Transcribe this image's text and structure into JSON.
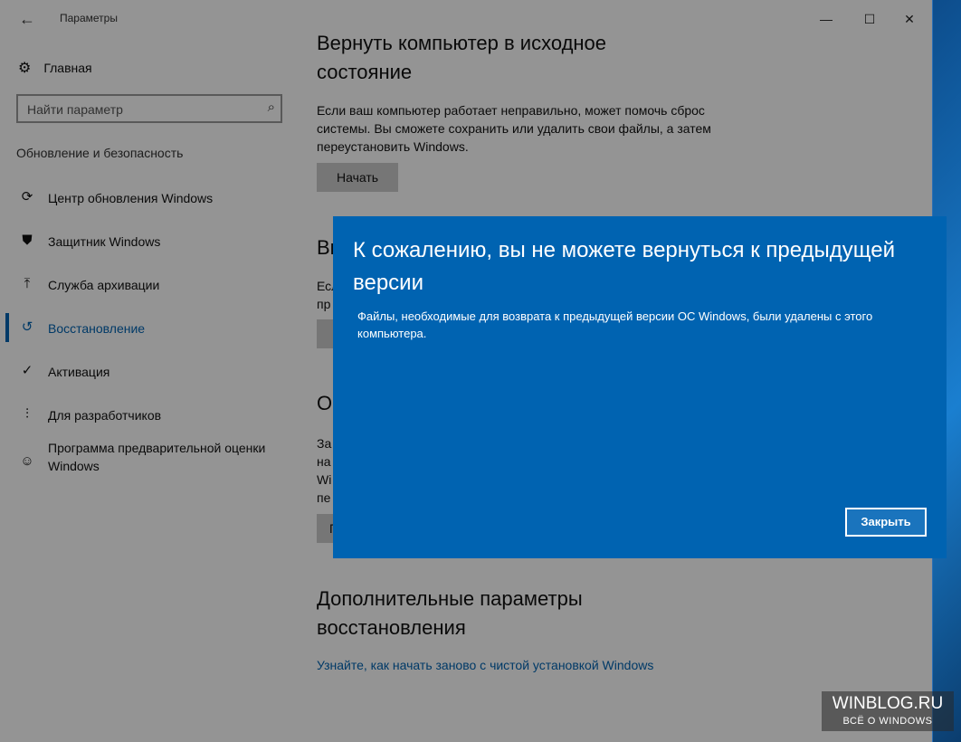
{
  "window": {
    "title": "Параметры",
    "back_glyph": "←",
    "minimize_glyph": "—",
    "maximize_glyph": "☐",
    "close_glyph": "✕"
  },
  "sidebar": {
    "home_label": "Главная",
    "home_icon": "gear-icon",
    "search_placeholder": "Найти параметр",
    "search_icon": "search-icon",
    "section_title": "Обновление и безопасность",
    "items": [
      {
        "label": "Центр обновления Windows",
        "icon": "refresh-icon",
        "glyph": "⟳",
        "active": false
      },
      {
        "label": "Защитник Windows",
        "icon": "shield-icon",
        "glyph": "⛊",
        "active": false
      },
      {
        "label": "Служба архивации",
        "icon": "backup-icon",
        "glyph": "⤒",
        "active": false
      },
      {
        "label": "Восстановление",
        "icon": "history-icon",
        "glyph": "↺",
        "active": true
      },
      {
        "label": "Активация",
        "icon": "check-circle-icon",
        "glyph": "✓",
        "active": false
      },
      {
        "label": "Для разработчиков",
        "icon": "developer-tools-icon",
        "glyph": "⫶",
        "active": false
      },
      {
        "label": "Программа предварительной оценки Windows",
        "icon": "insider-person-icon",
        "glyph": "☺",
        "active": false
      }
    ]
  },
  "content": {
    "reset": {
      "title": "Вернуть компьютер в исходное состояние",
      "description": "Если ваш компьютер работает неправильно, может помочь сброс системы. Вы сможете сохранить или удалить свои файлы, а затем переустановить Windows.",
      "button": "Начать"
    },
    "go_back_partial": {
      "title": "Вы",
      "line1": "Есл",
      "line2": "пр"
    },
    "special_boot_partial": {
      "title": "О",
      "line1": "За",
      "line2": "на",
      "line3": "Wi",
      "line4": "пе",
      "button": "П"
    },
    "advanced": {
      "title": "Дополнительные параметры восстановления",
      "link": "Узнайте, как начать заново с чистой установкой Windows"
    }
  },
  "dialog": {
    "title": "К сожалению, вы не можете вернуться к предыдущей версии",
    "message": "Файлы, необходимые для возврата к предыдущей версии ОС Windows, были удалены с этого компьютера.",
    "close_button": "Закрыть"
  },
  "watermark": {
    "line1": "WINBLOG.RU",
    "line2": "ВСЁ О WINDOWS"
  }
}
